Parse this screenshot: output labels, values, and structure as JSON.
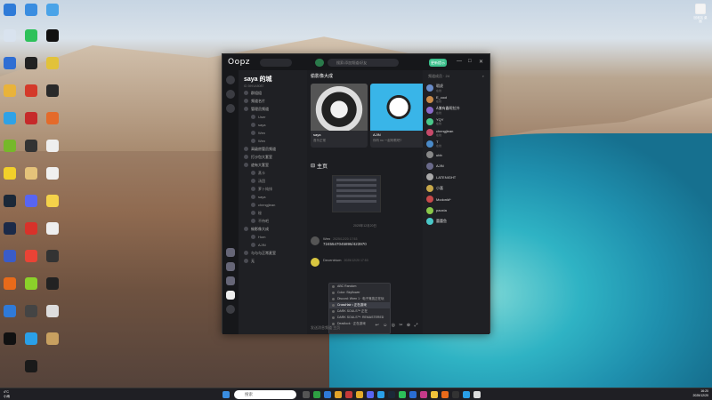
{
  "desktop": {
    "recycle_bin": "回收站\n桌面"
  },
  "app": {
    "logo": "Oopz",
    "search_placeholder": "搜索/添加频道/好友",
    "green_btn": "更新提示",
    "controls": [
      "—",
      "□",
      "✕"
    ]
  },
  "server": {
    "name": "saya 的城",
    "id": "ID 3991A5087",
    "items": [
      {
        "label": "群组组",
        "cnt": "",
        "sub": false
      },
      {
        "label": "频道名片",
        "cnt": "",
        "sub": false
      },
      {
        "label": "管理员频道",
        "cnt": "",
        "sub": false
      },
      {
        "label": "User",
        "cnt": "",
        "sub": true
      },
      {
        "label": "saya",
        "cnt": "",
        "sub": true
      },
      {
        "label": "Wen",
        "cnt": "",
        "sub": true
      },
      {
        "label": "Wen",
        "cnt": "",
        "sub": true
      },
      {
        "label": "高级房管员频道",
        "cnt": "",
        "sub": false
      },
      {
        "label": "打沙包大套室",
        "cnt": "",
        "sub": false
      },
      {
        "label": "遮有大套室",
        "cnt": "",
        "sub": false
      },
      {
        "label": "蒸卡",
        "cnt": "",
        "sub": true
      },
      {
        "label": "汤团",
        "cnt": "",
        "sub": true
      },
      {
        "label": "萝卜炖排",
        "cnt": "",
        "sub": true
      },
      {
        "label": "saya",
        "cnt": "",
        "sub": true
      },
      {
        "label": "chengjiean",
        "cnt": "",
        "sub": true
      },
      {
        "label": "秘",
        "cnt": "",
        "sub": true
      },
      {
        "label": "不待吧",
        "cnt": "",
        "sub": true
      },
      {
        "label": "偷影像大成",
        "cnt": "",
        "sub": false
      },
      {
        "label": "Hom",
        "cnt": "",
        "sub": true
      },
      {
        "label": "AJIN",
        "cnt": "",
        "sub": true
      },
      {
        "label": "与与与正常麦室",
        "cnt": "",
        "sub": false
      },
      {
        "label": "无",
        "cnt": "",
        "sub": false
      }
    ]
  },
  "main": {
    "channel": "偷影像大成",
    "home": "主页",
    "date": "2025年12月20日",
    "cards": [
      {
        "name": "saya",
        "status": "音乐正常"
      },
      {
        "name": "AJIN",
        "status": "你听 no 一起听歌吧?"
      }
    ],
    "messages": [
      {
        "user": "Wen",
        "time": "2025/12/20 17:53",
        "text": "7245547045896/423970"
      },
      {
        "user": "Decentrium",
        "time": "2025/12/20 17:53",
        "text": ""
      }
    ],
    "menu": [
      "ABC Random",
      "Color: Skyflower",
      "Discord: Wren 1 · 电子竞技正在玩",
      "CrossHair • 正在游戏",
      "DARK SOULS™ 正在",
      "DARK SOULS™: REMASTERED",
      "Deadlock · 正在游戏"
    ],
    "input_placeholder": "发送消息频道 主页",
    "input_icons": "↩ ☺ ◎ ✂ ⊕ ⤢"
  },
  "members": {
    "header": "频道成员 · 24",
    "list": [
      {
        "name": "瑕虎",
        "status": "在线"
      },
      {
        "name": "E_cool",
        "status": "在线"
      },
      {
        "name": "Å兼有鑫呢拉外",
        "status": "在线"
      },
      {
        "name": "YQY",
        "status": "在线"
      },
      {
        "name": "chengjiean",
        "status": "在线"
      },
      {
        "name": "T",
        "status": "在线"
      },
      {
        "name": "ubb",
        "status": ""
      },
      {
        "name": "AJIN",
        "status": ""
      },
      {
        "name": "LATENIGHT",
        "status": ""
      },
      {
        "name": "小喜",
        "status": ""
      },
      {
        "name": "Mcdonld*",
        "status": ""
      },
      {
        "name": "paoxia",
        "status": ""
      },
      {
        "name": "蕾蕾鱼",
        "status": ""
      }
    ]
  },
  "taskbar": {
    "search": "搜索",
    "weather_temp": "4°C",
    "weather": "小雨",
    "time": "16:20",
    "date": "2025/12/20"
  },
  "colors": {
    "accent": "#3bbf8b",
    "window_bg": "#1c1d21"
  }
}
